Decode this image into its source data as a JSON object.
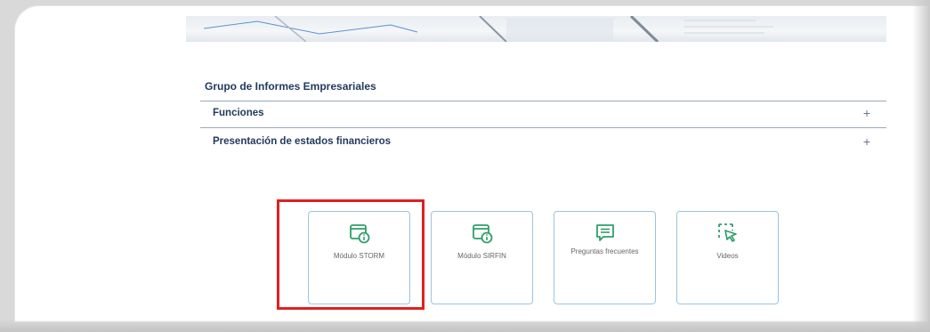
{
  "page": {
    "section_title": "Grupo de Informes Empresariales",
    "accordion": [
      {
        "label": "Funciones",
        "toggle": "+"
      },
      {
        "label": "Presentación de estados financieros",
        "toggle": "+"
      }
    ],
    "cards": [
      {
        "label": "Módulo STORM",
        "icon": "info-window-icon"
      },
      {
        "label": "Módulo SIRFIN",
        "icon": "info-window-icon"
      },
      {
        "label": "Preguntas frecuentes",
        "icon": "chat-bubble-icon"
      },
      {
        "label": "Videos",
        "icon": "cursor-select-icon"
      }
    ]
  },
  "colors": {
    "accent_green": "#2f9e6a",
    "heading_blue": "#223a5e",
    "card_border": "#9fc2dd",
    "highlight_red": "#e02020"
  }
}
